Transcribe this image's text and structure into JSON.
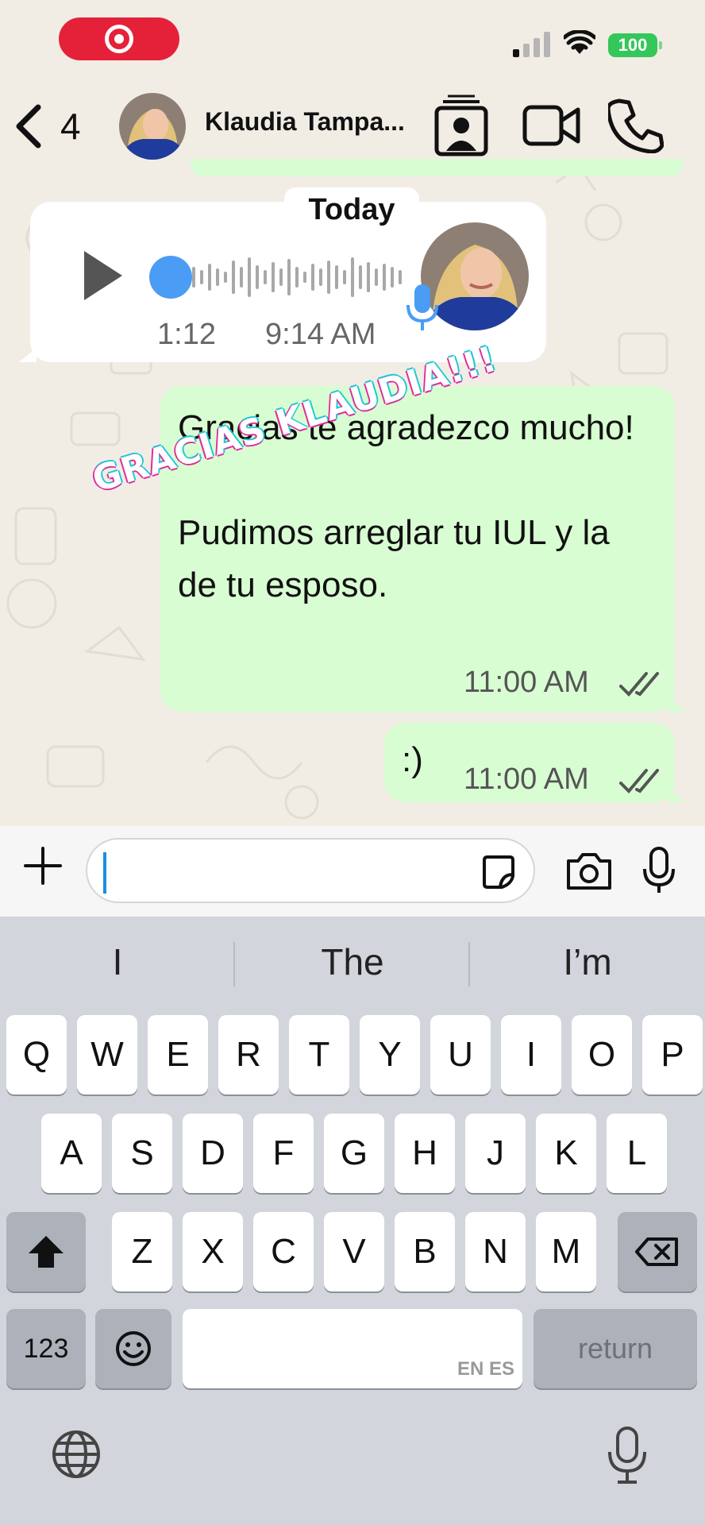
{
  "status_bar": {
    "battery": "100"
  },
  "header": {
    "back_count": "4",
    "contact_name": "Klaudia Tampa..."
  },
  "chat": {
    "date_label": "Today",
    "voice_message": {
      "duration": "1:12",
      "time": "9:14 AM"
    },
    "messages": [
      {
        "text": "Gracias te agradezco mucho!\n\nPudimos arreglar tu IUL y la de tu esposo.",
        "time": "11:00 AM",
        "status": "read"
      },
      {
        "text": ":)",
        "time": "11:00 AM",
        "status": "read"
      }
    ],
    "overlay_text": "GRACIAS KLAUDIA!!!"
  },
  "composer": {
    "input_value": "",
    "placeholder": ""
  },
  "keyboard": {
    "suggestions": [
      "I",
      "The",
      "I’m"
    ],
    "rows": [
      [
        "Q",
        "W",
        "E",
        "R",
        "T",
        "Y",
        "U",
        "I",
        "O",
        "P"
      ],
      [
        "A",
        "S",
        "D",
        "F",
        "G",
        "H",
        "J",
        "K",
        "L"
      ],
      [
        "Z",
        "X",
        "C",
        "V",
        "B",
        "N",
        "M"
      ]
    ],
    "numbers_label": "123",
    "language_label": "EN ES",
    "return_label": "return"
  },
  "colors": {
    "outgoing_bubble": "#d9fdd3",
    "accent_blue": "#4b9cf5",
    "record_red": "#e5213a",
    "battery_green": "#34c759"
  }
}
